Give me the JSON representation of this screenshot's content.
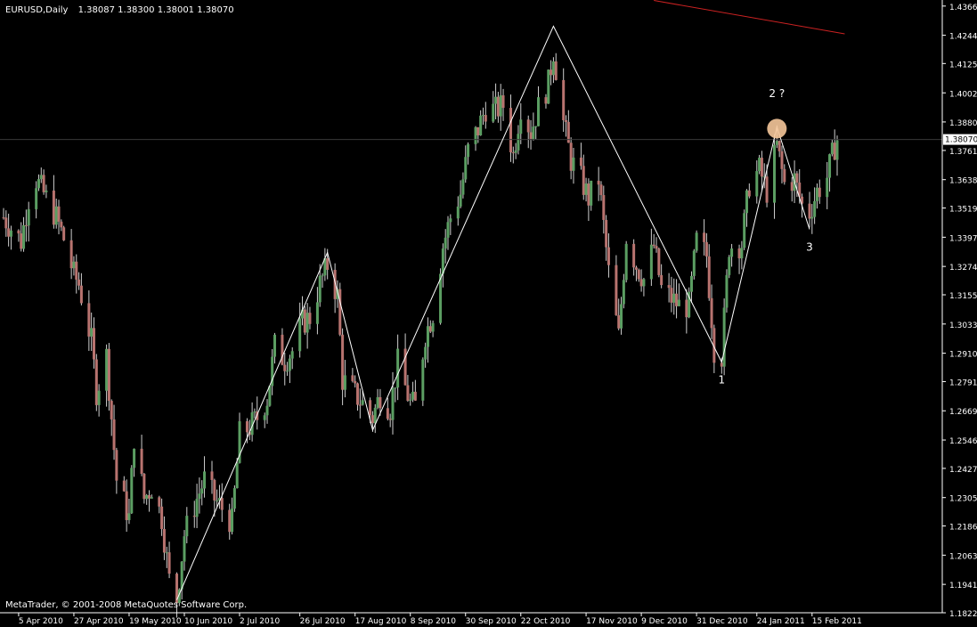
{
  "header": {
    "symbol": "EURUSD,Daily",
    "ohlc": "1.38087 1.38300 1.38001 1.38070"
  },
  "footer": {
    "copyright": "MetaTrader, © 2001-2008 MetaQuotes Software Corp."
  },
  "colors": {
    "background": "#000000",
    "axis": "#ffffff",
    "bull": "#5b9e62",
    "bear": "#b8736f",
    "wick": "#cfcfcf",
    "zigzag": "#ffffff",
    "trendline": "#cc2222",
    "marker": "#f5c79a",
    "current_price_line": "#3a3a3a"
  },
  "chart_data": {
    "type": "candlestick",
    "symbol": "EURUSD",
    "timeframe": "Daily",
    "last_price": "1.38070",
    "price_axis_ticks": [
      "1.43665",
      "1.42440",
      "1.41255",
      "1.40025",
      "1.38805",
      "1.37610",
      "1.36385",
      "1.35195",
      "1.33970",
      "1.32745",
      "1.31555",
      "1.30330",
      "1.29105",
      "1.27915",
      "1.26690",
      "1.25465",
      "1.24275",
      "1.23050",
      "1.21860",
      "1.20635",
      "1.19410",
      "1.18220"
    ],
    "date_axis_ticks": [
      "5 Apr 2010",
      "27 Apr 2010",
      "19 May 2010",
      "10 Jun 2010",
      "2 Jul 2010",
      "26 Jul 2010",
      "17 Aug 2010",
      "8 Sep 2010",
      "30 Sep 2010",
      "22 Oct 2010",
      "17 Nov 2010",
      "9 Dec 2010",
      "31 Dec 2010",
      "24 Jan 2011",
      "15 Feb 2011"
    ],
    "ylim": [
      1.1822,
      1.4377
    ],
    "date_range": [
      "2010-03-30",
      "2011-02-25"
    ],
    "zigzag": [
      {
        "date": "2010-06-07",
        "price": 1.1876
      },
      {
        "date": "2010-08-06",
        "price": 1.3333
      },
      {
        "date": "2010-08-24",
        "price": 1.2588
      },
      {
        "date": "2010-11-04",
        "price": 1.4282
      },
      {
        "date": "2011-01-10",
        "price": 1.2873
      },
      {
        "date": "2011-02-01",
        "price": 1.386
      },
      {
        "date": "2011-02-14",
        "price": 1.343
      }
    ],
    "trendline": [
      {
        "date": "2010-12-14",
        "price": 1.439
      },
      {
        "date": "2011-02-28",
        "price": 1.425
      }
    ],
    "annotations": [
      {
        "label": "1",
        "date": "2011-01-10",
        "price": 1.2783
      },
      {
        "label": "2 ?",
        "date": "2011-02-01",
        "price": 1.3985
      },
      {
        "label": "3",
        "date": "2011-02-14",
        "price": 1.334
      }
    ],
    "price_path": [
      [
        "2010-03-30",
        1.348
      ],
      [
        "2010-04-01",
        1.345
      ],
      [
        "2010-04-06",
        1.338
      ],
      [
        "2010-04-09",
        1.356
      ],
      [
        "2010-04-12",
        1.364
      ],
      [
        "2010-04-14",
        1.36
      ],
      [
        "2010-04-20",
        1.348
      ],
      [
        "2010-04-23",
        1.339
      ],
      [
        "2010-04-27",
        1.324
      ],
      [
        "2010-04-29",
        1.32
      ],
      [
        "2010-05-04",
        1.296
      ],
      [
        "2010-05-06",
        1.275
      ],
      [
        "2010-05-10",
        1.29
      ],
      [
        "2010-05-14",
        1.238
      ],
      [
        "2010-05-19",
        1.222
      ],
      [
        "2010-05-21",
        1.256
      ],
      [
        "2010-05-25",
        1.23
      ],
      [
        "2010-05-28",
        1.235
      ],
      [
        "2010-06-01",
        1.222
      ],
      [
        "2010-06-04",
        1.196
      ],
      [
        "2010-06-07",
        1.188
      ],
      [
        "2010-06-10",
        1.215
      ],
      [
        "2010-06-15",
        1.23
      ],
      [
        "2010-06-18",
        1.238
      ],
      [
        "2010-06-22",
        1.23
      ],
      [
        "2010-06-25",
        1.226
      ],
      [
        "2010-06-29",
        1.22
      ],
      [
        "2010-07-02",
        1.257
      ],
      [
        "2010-07-06",
        1.26
      ],
      [
        "2010-07-09",
        1.264
      ],
      [
        "2010-07-13",
        1.272
      ],
      [
        "2010-07-16",
        1.294
      ],
      [
        "2010-07-20",
        1.288
      ],
      [
        "2010-07-23",
        1.292
      ],
      [
        "2010-07-27",
        1.304
      ],
      [
        "2010-07-30",
        1.306
      ],
      [
        "2010-08-03",
        1.32
      ],
      [
        "2010-08-06",
        1.328
      ],
      [
        "2010-08-10",
        1.315
      ],
      [
        "2010-08-12",
        1.28
      ],
      [
        "2010-08-16",
        1.275
      ],
      [
        "2010-08-20",
        1.27
      ],
      [
        "2010-08-24",
        1.264
      ],
      [
        "2010-08-27",
        1.274
      ],
      [
        "2010-08-31",
        1.268
      ],
      [
        "2010-09-03",
        1.287
      ],
      [
        "2010-09-08",
        1.27
      ],
      [
        "2010-09-10",
        1.269
      ],
      [
        "2010-09-14",
        1.299
      ],
      [
        "2010-09-17",
        1.308
      ],
      [
        "2010-09-21",
        1.336
      ],
      [
        "2010-09-24",
        1.348
      ],
      [
        "2010-09-28",
        1.358
      ],
      [
        "2010-10-01",
        1.376
      ],
      [
        "2010-10-05",
        1.385
      ],
      [
        "2010-10-08",
        1.394
      ],
      [
        "2010-10-12",
        1.393
      ],
      [
        "2010-10-15",
        1.395
      ],
      [
        "2010-10-19",
        1.374
      ],
      [
        "2010-10-22",
        1.395
      ],
      [
        "2010-10-26",
        1.384
      ],
      [
        "2010-10-29",
        1.394
      ],
      [
        "2010-11-02",
        1.404
      ],
      [
        "2010-11-04",
        1.418
      ],
      [
        "2010-11-08",
        1.388
      ],
      [
        "2010-11-11",
        1.372
      ],
      [
        "2010-11-15",
        1.364
      ],
      [
        "2010-11-18",
        1.356
      ],
      [
        "2010-11-22",
        1.364
      ],
      [
        "2010-11-26",
        1.325
      ],
      [
        "2010-11-30",
        1.298
      ],
      [
        "2010-12-03",
        1.34
      ],
      [
        "2010-12-07",
        1.328
      ],
      [
        "2010-12-10",
        1.322
      ],
      [
        "2010-12-14",
        1.336
      ],
      [
        "2010-12-17",
        1.318
      ],
      [
        "2010-12-21",
        1.314
      ],
      [
        "2010-12-24",
        1.311
      ],
      [
        "2010-12-28",
        1.311
      ],
      [
        "2010-12-31",
        1.338
      ],
      [
        "2011-01-04",
        1.332
      ],
      [
        "2011-01-07",
        1.293
      ],
      [
        "2011-01-10",
        1.29
      ],
      [
        "2011-01-13",
        1.336
      ],
      [
        "2011-01-18",
        1.337
      ],
      [
        "2011-01-21",
        1.362
      ],
      [
        "2011-01-25",
        1.368
      ],
      [
        "2011-01-28",
        1.359
      ],
      [
        "2011-02-01",
        1.378
      ],
      [
        "2011-02-04",
        1.362
      ],
      [
        "2011-02-08",
        1.364
      ],
      [
        "2011-02-11",
        1.353
      ],
      [
        "2011-02-14",
        1.35
      ],
      [
        "2011-02-17",
        1.359
      ],
      [
        "2011-02-21",
        1.365
      ],
      [
        "2011-02-24",
        1.378
      ],
      [
        "2011-02-25",
        1.3807
      ]
    ]
  }
}
